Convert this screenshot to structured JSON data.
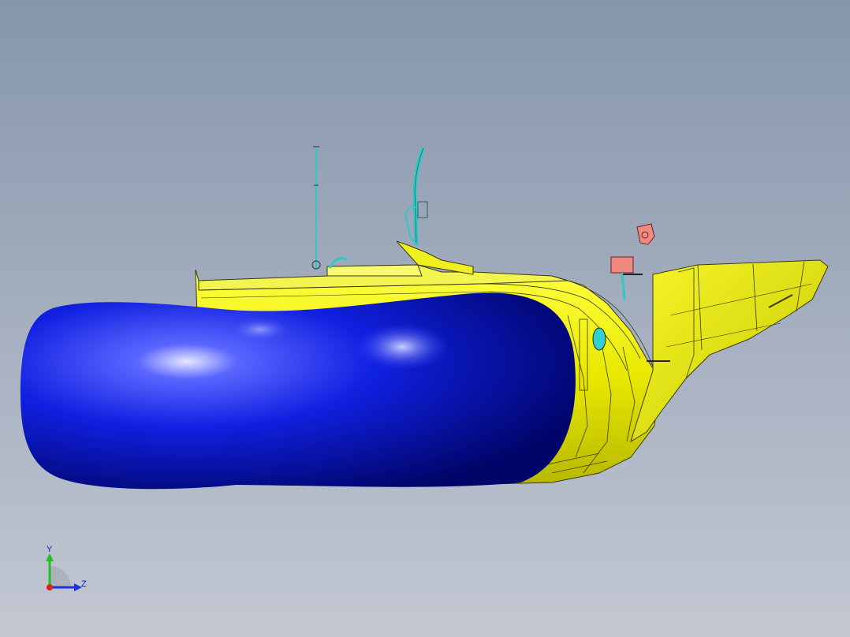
{
  "viewport": {
    "background_top": "#8796ab",
    "background_bottom": "#c3c8d2"
  },
  "model": {
    "hull_color": "#f2f200",
    "float_color": "#0a16d8",
    "fitting_color": "#36d6d2",
    "bracket_color": "#f08a80",
    "edge_color": "#333300"
  },
  "triad": {
    "x_color": "#e02020",
    "y_color": "#20c020",
    "z_color": "#2030e0",
    "y_label": "Y",
    "z_label": "Z"
  }
}
